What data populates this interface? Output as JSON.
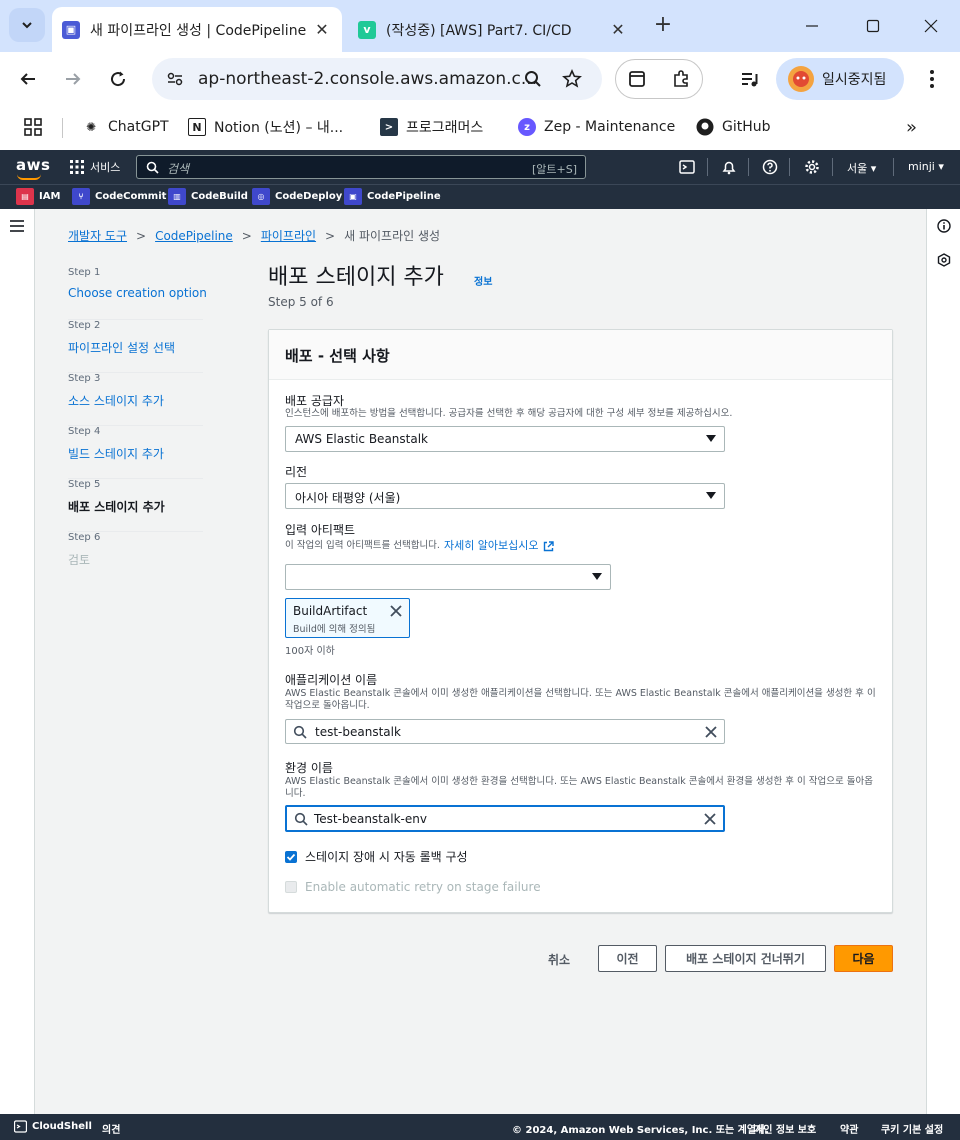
{
  "browser": {
    "tabs": [
      {
        "title": "새 파이프라인 생성 | CodePipeline",
        "active": true
      },
      {
        "title": "(작성중) [AWS] Part7. CI/CD",
        "active": false
      }
    ],
    "url": "ap-northeast-2.console.aws.amazon.c...",
    "profile_status": "일시중지됨",
    "bookmarks": [
      "ChatGPT",
      "Notion (노션) – 내...",
      "프로그래머스",
      "Zep - Maintenance",
      "GitHub"
    ]
  },
  "aws_header": {
    "logo": "aws",
    "services_label": "서비스",
    "search_placeholder": "검색",
    "search_shortcut": "[알트+S]",
    "region": "서울 ▾",
    "user": "minji ▾",
    "favorites": [
      "IAM",
      "CodeCommit",
      "CodeBuild",
      "CodeDeploy",
      "CodePipeline"
    ]
  },
  "breadcrumb": {
    "items": [
      "개발자 도구",
      "CodePipeline",
      "파이프라인"
    ],
    "current": "새 파이프라인 생성"
  },
  "steps": [
    {
      "num": "Step 1",
      "label": "Choose creation option",
      "state": "done"
    },
    {
      "num": "Step 2",
      "label": "파이프라인 설정 선택",
      "state": "done"
    },
    {
      "num": "Step 3",
      "label": "소스 스테이지 추가",
      "state": "done"
    },
    {
      "num": "Step 4",
      "label": "빌드 스테이지 추가",
      "state": "done"
    },
    {
      "num": "Step 5",
      "label": "배포 스테이지 추가",
      "state": "current"
    },
    {
      "num": "Step 6",
      "label": "검토",
      "state": "disabled"
    }
  ],
  "page": {
    "title": "배포 스테이지 추가",
    "info": "정보",
    "step_of": "Step 5 of 6"
  },
  "panel": {
    "title": "배포 - 선택 사항",
    "provider": {
      "label": "배포 공급자",
      "desc": "인스턴스에 배포하는 방법을 선택합니다. 공급자를 선택한 후 해당 공급자에 대한 구성 세부 정보를 제공하십시오.",
      "value": "AWS Elastic Beanstalk"
    },
    "region": {
      "label": "리전",
      "value": "아시아 태평양 (서울)"
    },
    "artifact": {
      "label": "입력 아티팩트",
      "desc": "이 작업의 입력 아티팩트를 선택합니다.",
      "learn_more": "자세히 알아보십시오",
      "value": "",
      "token_name": "BuildArtifact",
      "token_sub": "Build에 의해 정의됨",
      "hint": "100자 이하"
    },
    "application": {
      "label": "애플리케이션 이름",
      "desc": "AWS Elastic Beanstalk 콘솔에서 이미 생성한 애플리케이션을 선택합니다. 또는 AWS Elastic Beanstalk 콘솔에서 애플리케이션을 생성한 후 이 작업으로 돌아옵니다.",
      "value": "test-beanstalk"
    },
    "environment": {
      "label": "환경 이름",
      "desc": "AWS Elastic Beanstalk 콘솔에서 이미 생성한 환경을 선택합니다. 또는 AWS Elastic Beanstalk 콘솔에서 환경을 생성한 후 이 작업으로 돌아옵니다.",
      "value": "Test-beanstalk-env"
    },
    "rollback_label": "스테이지 장애 시 자동 롤백 구성",
    "rollback_checked": true,
    "retry_label": "Enable automatic retry on stage failure",
    "retry_checked": false
  },
  "actions": {
    "cancel": "취소",
    "previous": "이전",
    "skip": "배포 스테이지 건너뛰기",
    "next": "다음"
  },
  "footer": {
    "cloudshell": "CloudShell",
    "feedback": "의견",
    "copyright": "© 2024, Amazon Web Services, Inc. 또는 계열사.",
    "privacy": "개인 정보 보호",
    "terms": "약관",
    "cookies": "쿠키 기본 설정"
  },
  "colors": {
    "aws_nav": "#232f3e",
    "link": "#0972d3",
    "primary_button": "#ff9900",
    "chrome_tabstrip": "#d3e3fd"
  }
}
